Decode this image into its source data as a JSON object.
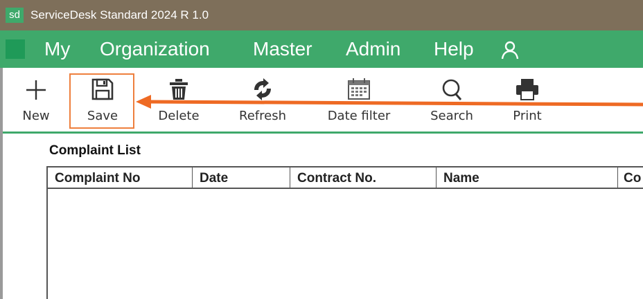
{
  "app": {
    "logo": "sd",
    "title": "ServiceDesk Standard 2024 R 1.0"
  },
  "menu": {
    "items": [
      {
        "label": "My"
      },
      {
        "label": "Organization"
      },
      {
        "label": "Master"
      },
      {
        "label": "Admin"
      },
      {
        "label": "Help"
      }
    ],
    "user_icon": "user-icon"
  },
  "toolbar": {
    "new": {
      "label": "New",
      "icon": "plus-icon"
    },
    "save": {
      "label": "Save",
      "icon": "floppy-disk-icon"
    },
    "delete": {
      "label": "Delete",
      "icon": "trash-icon"
    },
    "refresh": {
      "label": "Refresh",
      "icon": "refresh-icon"
    },
    "date_filter": {
      "label": "Date filter",
      "icon": "calendar-icon"
    },
    "search": {
      "label": "Search",
      "icon": "search-icon"
    },
    "print": {
      "label": "Print",
      "icon": "printer-icon"
    }
  },
  "complaint_list": {
    "title": "Complaint List",
    "columns": [
      "Complaint No",
      "Date",
      "Contract No.",
      "Name",
      "Co"
    ],
    "rows": []
  },
  "colors": {
    "accent": "#3fa96b",
    "titlebar": "#7e6f5a",
    "highlight": "#ee7f3d"
  }
}
